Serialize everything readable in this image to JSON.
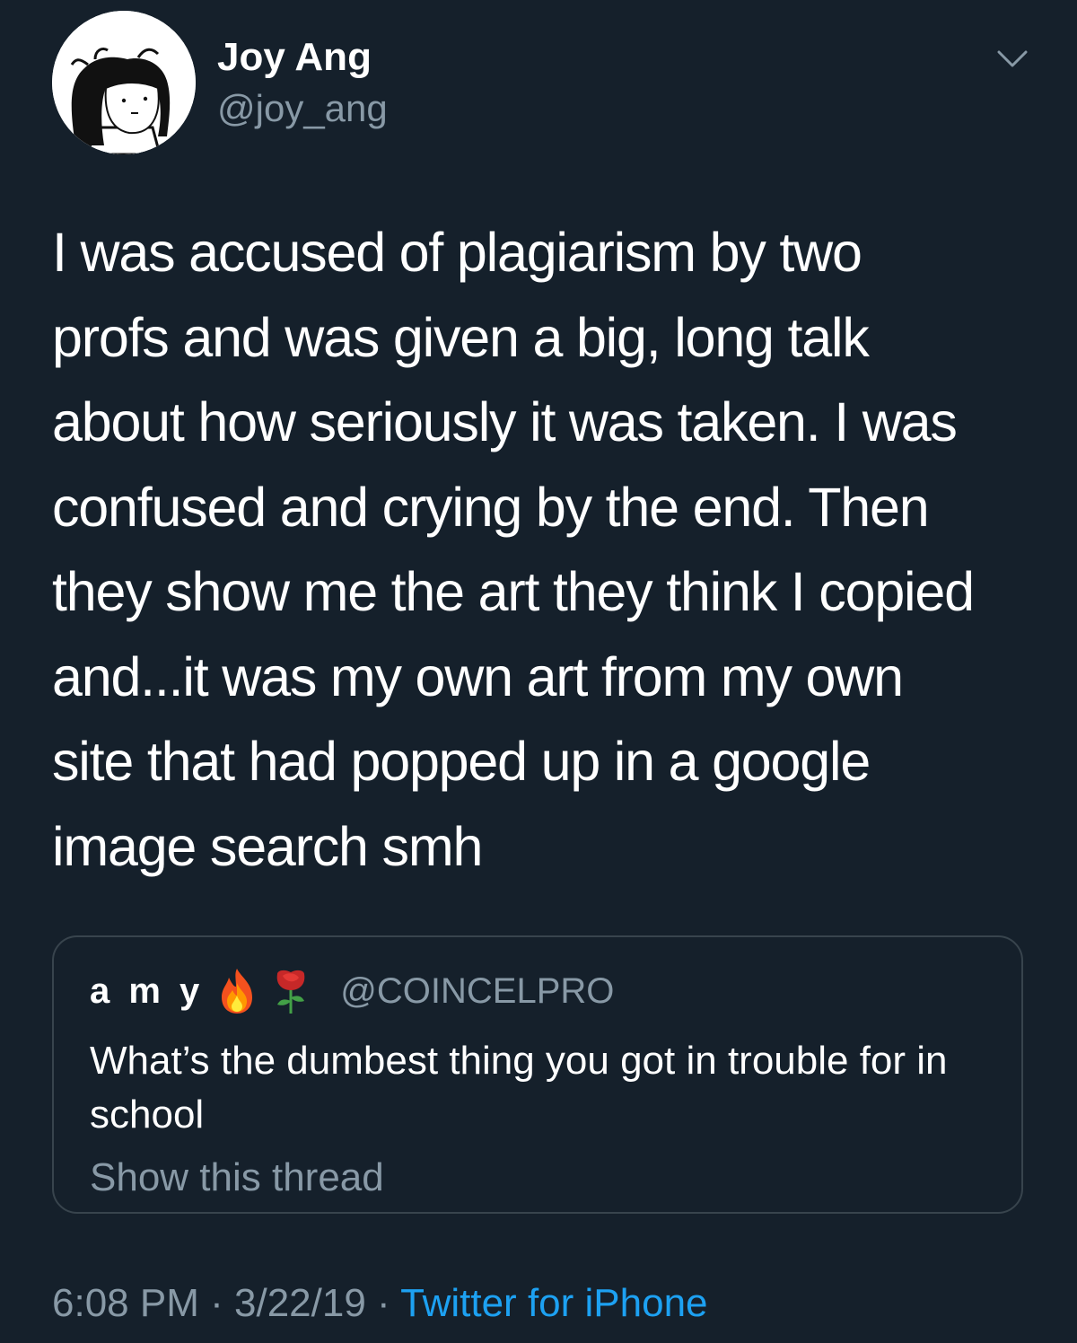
{
  "author": {
    "display_name": "Joy Ang",
    "handle": "@joy_ang"
  },
  "tweet": {
    "text": "I was accused of plagiarism by two\nprofs and was given a big, long talk\nabout how seriously it was taken. I was\nconfused and crying by the end. Then\nthey show me the art they think I copied\nand...it was my own art from my own\nsite that had popped up in a google\nimage search smh"
  },
  "quoted_tweet": {
    "author_name": "a m y",
    "emojis": [
      "fire-emoji",
      "rose-emoji"
    ],
    "author_handle": "@COINCELPRO",
    "text": "What’s the dumbest thing you got in trouble for in school",
    "show_thread_label": "Show this thread"
  },
  "meta": {
    "time": "6:08 PM",
    "date": "3/22/19",
    "separator": "·",
    "source": "Twitter for iPhone"
  },
  "colors": {
    "background": "#15202b",
    "secondary_text": "#8899a6",
    "link": "#1da1f2",
    "border": "#38444d"
  }
}
